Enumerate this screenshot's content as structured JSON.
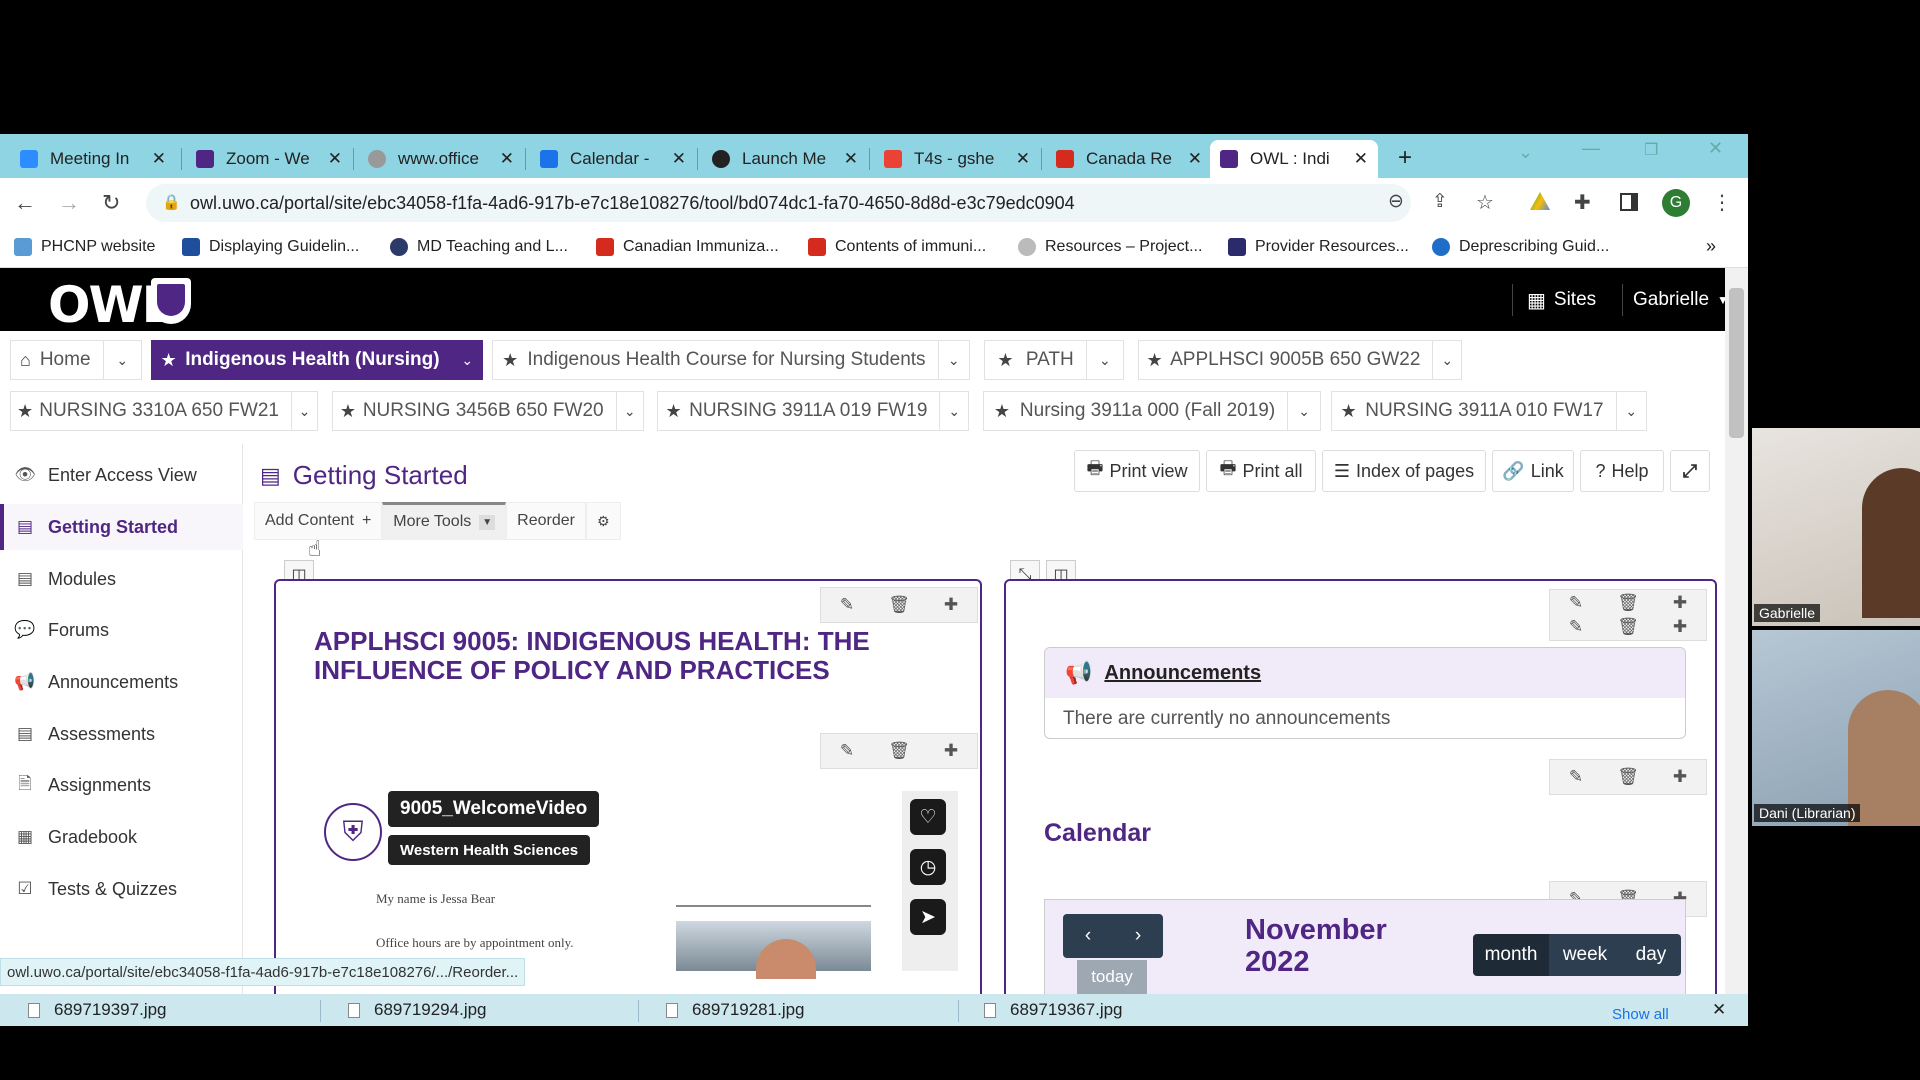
{
  "browser": {
    "tabs": [
      {
        "label": "Meeting In",
        "color": "#2d8cff"
      },
      {
        "label": "Zoom - We",
        "color": "#4f2683"
      },
      {
        "label": "www.office",
        "color": "#999999"
      },
      {
        "label": "Calendar -",
        "color": "#1a73e8"
      },
      {
        "label": "Launch Me",
        "color": "#222222"
      },
      {
        "label": "T4s - gshe",
        "color": "#ea4335"
      },
      {
        "label": "Canada Re",
        "color": "#d52b1e"
      },
      {
        "label": "OWL : Indi",
        "color": "#4f2683"
      }
    ],
    "url": "owl.uwo.ca/portal/site/ebc34058-f1fa-4ad6-917b-e7c18e108276/tool/bd074dc1-fa70-4650-8d8d-e3c79edc0904",
    "profile_initial": "G",
    "bookmarks": [
      "PHCNP website",
      "Displaying Guidelin...",
      "MD Teaching and L...",
      "Canadian Immuniza...",
      "Contents of immuni...",
      "Resources – Project...",
      "Provider Resources...",
      "Deprescribing Guid..."
    ]
  },
  "owl": {
    "logo": "OWL",
    "sites_label": "Sites",
    "user": "Gabrielle"
  },
  "site_nav": {
    "row1": [
      {
        "label": "Home",
        "star": false
      },
      {
        "label": "Indigenous Health (Nursing)",
        "star": true,
        "active": true
      },
      {
        "label": "Indigenous Health Course for Nursing Students",
        "star": true
      },
      {
        "label": "PATH",
        "star": true
      },
      {
        "label": "APPLHSCI 9005B 650 GW22",
        "star": true
      }
    ],
    "row2": [
      {
        "label": "NURSING 3310A 650 FW21",
        "star": true
      },
      {
        "label": "NURSING 3456B 650 FW20",
        "star": true
      },
      {
        "label": "NURSING 3911A 019 FW19",
        "star": true
      },
      {
        "label": "Nursing 3911a 000 (Fall 2019)",
        "star": true
      },
      {
        "label": "NURSING 3911A 010 FW17",
        "star": true
      }
    ]
  },
  "tool_menu": [
    {
      "label": "Enter Access View",
      "icon": "eye-icon"
    },
    {
      "label": "Getting Started",
      "icon": "book-icon",
      "active": true
    },
    {
      "label": "Modules",
      "icon": "book-icon"
    },
    {
      "label": "Forums",
      "icon": "comments-icon"
    },
    {
      "label": "Announcements",
      "icon": "bullhorn-icon"
    },
    {
      "label": "Assessments",
      "icon": "book-icon"
    },
    {
      "label": "Assignments",
      "icon": "file-icon"
    },
    {
      "label": "Gradebook",
      "icon": "table-icon"
    },
    {
      "label": "Tests & Quizzes",
      "icon": "check-square-icon"
    }
  ],
  "page": {
    "title": "Getting Started",
    "buttons": {
      "print_view": "Print view",
      "print_all": "Print all",
      "index": "Index of pages",
      "link": "Link",
      "help": "Help"
    },
    "lessonbuilder": {
      "add_content": "Add Content",
      "more_tools": "More Tools",
      "reorder": "Reorder"
    },
    "course_heading": "APPLHSCI 9005: INDIGENOUS HEALTH: THE INFLUENCE OF POLICY AND PRACTICES",
    "video": {
      "title": "9005_WelcomeVideo",
      "channel": "Western Health Sciences",
      "line1": "My name is Jessa Bear",
      "line2": "Office hours are by appointment only."
    },
    "announcements": {
      "title": "Announcements",
      "empty": "There are currently no announcements"
    },
    "calendar": {
      "title": "Calendar",
      "month_label": "November 2022",
      "today": "today",
      "views": [
        "month",
        "week",
        "day"
      ]
    }
  },
  "status_url": "owl.uwo.ca/portal/site/ebc34058-f1fa-4ad6-917b-e7c18e108276/.../Reorder...",
  "downloads": {
    "files": [
      "689719397.jpg",
      "689719294.jpg",
      "689719281.jpg",
      "689719367.jpg"
    ],
    "show_all": "Show all"
  },
  "participants": [
    "Gabrielle",
    "Dani (Librarian)"
  ],
  "colors": {
    "owl_purple": "#4f2683",
    "tab_bar": "#8fd4e3"
  }
}
